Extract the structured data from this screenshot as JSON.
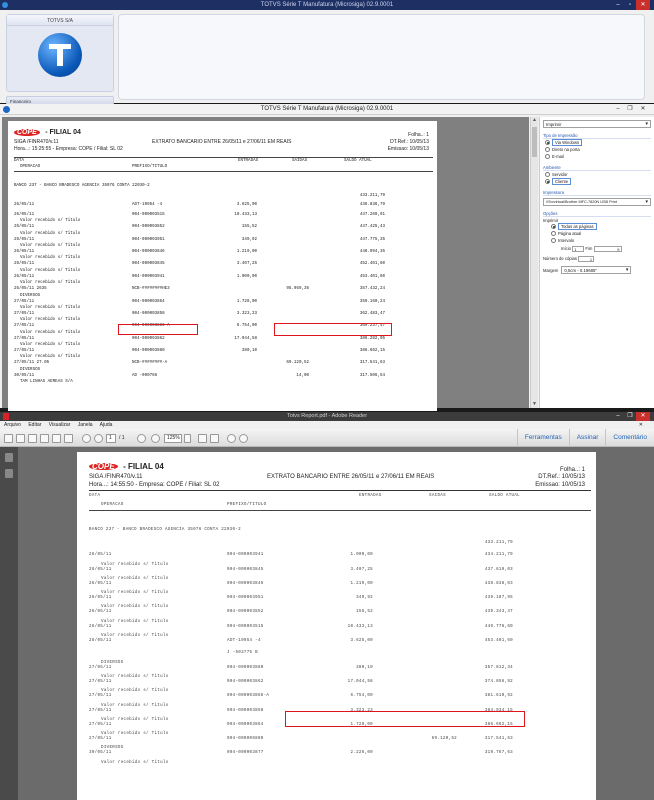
{
  "window1": {
    "title": "TOTVS Série T Manufatura (Microsiga) 02.9.0001",
    "card_title": "TOTVS S/A",
    "menu_item": "Financeiro"
  },
  "window2": {
    "title": "TOTVS Série T Manufatura (Microsiga) 02.9.0001",
    "report": {
      "company_logo": "COPE",
      "filial": "- FILIAL 04",
      "program": "SIGA /FINR470/v.11",
      "hora": "Hora...: 15:25:55 - Empresa: COPE / Filial: SL 02",
      "title": "EXTRATO BANCARIO ENTRE  26/05/11 e 27/06/11  EM  REAIS",
      "folha": "Folha..:    1",
      "dtref": "DT.Ref.: 10/05/13",
      "emissao": "Emissao: 10/05/13"
    },
    "columns": {
      "data": "DATA",
      "operacao": "OPERACAO",
      "prefixo": "PREFIXO/TITULO",
      "entradas": "ENTRADAS",
      "saidas": "SAIDAS",
      "saldo": "SALDO ATUAL"
    },
    "bank_line": "BANCO 237 - BANCO BRADESCO   AGENCIA 35076   CONTA 22030-2",
    "rows": [
      {
        "date": "",
        "desc": "",
        "titulo": "",
        "entradas": "",
        "saidas": "",
        "saldo": "433.211,79"
      },
      {
        "date": "26/05/11",
        "desc": "",
        "titulo": "ADT-10954    -4",
        "entradas": "3.625,00",
        "saidas": "",
        "saldo": "436.836,79"
      },
      {
        "date": "26/05/11",
        "desc": "Valor recebido s/ Titulo",
        "titulo": "004-000003515",
        "entradas": "10.433,13",
        "saidas": "",
        "saldo": "447.269,91"
      },
      {
        "date": "26/05/11",
        "desc": "Valor recebido s/ Titulo",
        "titulo": "004-000003852",
        "entradas": "155,52",
        "saidas": "",
        "saldo": "447.425,43"
      },
      {
        "date": "26/05/11",
        "desc": "Valor recebido s/ Titulo",
        "titulo": "004-000003951",
        "entradas": "349,92",
        "saidas": "",
        "saldo": "447.775,35"
      },
      {
        "date": "26/05/11",
        "desc": "Valor recebido s/ Titulo",
        "titulo": "004-000003846",
        "entradas": "1.219,00",
        "saidas": "",
        "saldo": "448.994,35"
      },
      {
        "date": "26/05/11",
        "desc": "Valor recebido s/ Titulo",
        "titulo": "004-000003845",
        "entradas": "3.407,25",
        "saidas": "",
        "saldo": "452.401,60"
      },
      {
        "date": "26/05/11",
        "desc": "Valor recebido s/ Titulo",
        "titulo": "004-000003941",
        "entradas": "1.000,00",
        "saidas": "",
        "saldo": "453.401,60"
      },
      {
        "date": "26/05/11  2635",
        "desc": "DIVERSOS",
        "titulo": "NCB-########HE3",
        "entradas": "",
        "saidas": "95.969,36",
        "saldo": "357.432,24"
      },
      {
        "date": "27/05/11",
        "desc": "Valor recebido s/ Titulo",
        "titulo": "004-000003864",
        "entradas": "1.728,00",
        "saidas": "",
        "saldo": "359.160,24"
      },
      {
        "date": "27/05/11",
        "desc": "Valor recebido s/ Titulo",
        "titulo": "004-000003858",
        "entradas": "3.323,23",
        "saidas": "",
        "saldo": "362.483,47"
      },
      {
        "date": "27/05/11",
        "desc": "Valor recebido s/ Titulo",
        "titulo": "004-000003866-A",
        "entradas": "6.754,00",
        "saidas": "",
        "saldo": "369.237,47"
      },
      {
        "date": "27/05/11",
        "desc": "Valor recebido s/ Titulo",
        "titulo": "004-000003862",
        "entradas": "17.044,58",
        "saidas": "",
        "saldo": "386.282,05"
      },
      {
        "date": "27/05/11",
        "desc": "Valor recebido s/ Titulo",
        "titulo": "004-000003880",
        "entradas": "380,10",
        "saidas": "",
        "saldo": "386.662,15"
      },
      {
        "date": "27/05/11  27.05",
        "desc": "DIVERSOS",
        "titulo": "NCB-########-A",
        "entradas": "",
        "saidas": "69.120,52",
        "saldo": "317.541,63"
      },
      {
        "date": "30/05/11",
        "desc": "TAM LINHAS AEREAS S/A",
        "titulo": "AD  -000766",
        "entradas": "",
        "saidas": "14,00",
        "saldo": "317.506,54"
      }
    ],
    "options": {
      "destination_select": "Imprimir",
      "tipo_label": "Tipo de Impressão",
      "tipo_options": [
        "Via Windows",
        "Direto na porta",
        "E-mail"
      ],
      "ambiente_label": "Ambiente",
      "ambiente_options": [
        "Servidor",
        "Cliente"
      ],
      "impressora_label": "Impressora",
      "impressora_value": "\\\\Srvvirtual\\Brother MFC-7820N USB Print",
      "opcoes_label": "Opções",
      "imprimir_label": "Imprimir",
      "imprimir_options": [
        "Todas as páginas",
        "Página atual",
        "Intervalo"
      ],
      "inicio_label": "Início",
      "inicio_value": "1",
      "fim_label": "Fim",
      "fim_value": "9",
      "copias_label": "Número de cópias",
      "copias_value": "1",
      "margem_label": "Margem",
      "margem_value": "0,5cm - 0.19685\""
    }
  },
  "window3": {
    "title": "Totvs Report.pdf - Adobe Reader",
    "menu": [
      "Arquivo",
      "Editar",
      "Visualizar",
      "Janela",
      "Ajuda"
    ],
    "page_current": "1",
    "page_total": "/ 1",
    "zoom": "125%",
    "right_tabs": [
      "Ferramentas",
      "Assinar",
      "Comentário"
    ],
    "report": {
      "company_logo": "COPE",
      "filial": "- FILIAL 04",
      "program": "SIGA /FINR470/v.11",
      "hora": "Hora...: 14:55:50 - Empresa: COPE / Filial: SL 02",
      "title": "EXTRATO BANCARIO ENTRE  26/05/11 e 27/06/11  EM  REAIS",
      "folha": "Folha..:    1",
      "dtref": "DT.Ref.: 10/05/13",
      "emissao": "Emissao: 10/05/13"
    },
    "bank_line": "BANCO 237 - BANCO BRADESCO   AGENCIA 35076   CONTA 22030-2",
    "rows": [
      {
        "date": "",
        "desc": "",
        "titulo": "",
        "entradas": "",
        "saidas": "",
        "saldo": "433.211,79"
      },
      {
        "date": "26/05/11",
        "desc": "Valor recebido s/ Titulo",
        "titulo": "004-000003941",
        "entradas": "1.000,00",
        "saidas": "",
        "saldo": "434.211,79"
      },
      {
        "date": "26/05/11",
        "desc": "Valor recebido s/ Titulo",
        "titulo": "004-000003845",
        "entradas": "3.407,25",
        "saidas": "",
        "saldo": "437.619,03"
      },
      {
        "date": "26/05/11",
        "desc": "Valor recebido s/ Titulo",
        "titulo": "004-000003846",
        "entradas": "1.219,00",
        "saidas": "",
        "saldo": "438.838,03"
      },
      {
        "date": "26/05/11",
        "desc": "Valor recebido s/ Titulo",
        "titulo": "004-000003951",
        "entradas": "349,92",
        "saidas": "",
        "saldo": "439.187,95"
      },
      {
        "date": "26/05/11",
        "desc": "Valor recebido s/ Titulo",
        "titulo": "004-000003852",
        "entradas": "155,52",
        "saidas": "",
        "saldo": "439.343,47"
      },
      {
        "date": "26/05/11",
        "desc": "Valor recebido s/ Titulo",
        "titulo": "004-000003515",
        "entradas": "10.433,13",
        "saidas": "",
        "saldo": "449.776,60"
      },
      {
        "date": "26/05/11",
        "desc": "",
        "titulo": "ADT-10954    -4",
        "entradas": "3.625,00",
        "saidas": "",
        "saldo": "453.401,60"
      },
      {
        "date": "",
        "desc": "DIVERSOS",
        "titulo": "J   -503775   B",
        "entradas": "",
        "saidas": "",
        "saldo": ""
      },
      {
        "date": "27/05/11",
        "desc": "Valor recebido s/ Titulo",
        "titulo": "004-000003880",
        "entradas": "380,10",
        "saidas": "",
        "saldo": "357.812,34"
      },
      {
        "date": "27/05/11",
        "desc": "Valor recebido s/ Titulo",
        "titulo": "004-000003862",
        "entradas": "17.044,58",
        "saidas": "",
        "saldo": "374.856,92"
      },
      {
        "date": "27/05/11",
        "desc": "Valor recebido s/ Titulo",
        "titulo": "004-000003866-A",
        "entradas": "6.754,00",
        "saidas": "",
        "saldo": "381.610,92"
      },
      {
        "date": "27/05/11",
        "desc": "Valor recebido s/ Titulo",
        "titulo": "004-000003858",
        "entradas": "3.323,23",
        "saidas": "",
        "saldo": "384.934,15"
      },
      {
        "date": "27/05/11",
        "desc": "Valor recebido s/ Titulo",
        "titulo": "004-000003864",
        "entradas": "1.728,00",
        "saidas": "",
        "saldo": "386.662,15"
      },
      {
        "date": "27/05/11",
        "desc": "DIVERSOS",
        "titulo": "004-000006880",
        "entradas": "",
        "saidas": "69.120,52",
        "saldo": "317.541,63"
      },
      {
        "date": "30/05/11",
        "desc": "Valor recebido s/ Titulo",
        "titulo": "004-000003877",
        "entradas": "2.226,00",
        "saidas": "",
        "saldo": "319.767,63"
      }
    ]
  }
}
